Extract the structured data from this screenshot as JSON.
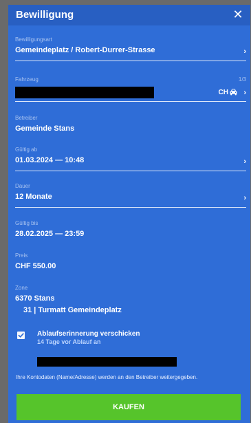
{
  "header": {
    "title": "Bewilligung",
    "close_glyph": "✕"
  },
  "fields": {
    "bewilligungsart": {
      "label": "Bewilligungsart",
      "value": "Gemeindeplatz / Robert-Durrer-Strasse"
    },
    "fahrzeug": {
      "label": "Fahrzeug",
      "counter": "1/3",
      "country": "CH",
      "icon": "car-icon"
    },
    "betreiber": {
      "label": "Betreiber",
      "value": "Gemeinde Stans"
    },
    "gueltig_ab": {
      "label": "Gültig ab",
      "value": "01.03.2024 — 10:48"
    },
    "dauer": {
      "label": "Dauer",
      "value": "12 Monate"
    },
    "gueltig_bis": {
      "label": "Gültig bis",
      "value": "28.02.2025 — 23:59"
    },
    "preis": {
      "label": "Preis",
      "value": "CHF 550.00"
    },
    "zone": {
      "label": "Zone",
      "value": "6370 Stans",
      "sub_value": "31 | Turmatt Gemeindeplatz"
    }
  },
  "chevron": "›",
  "reminder": {
    "checked": true,
    "label": "Ablaufserinnerung verschicken",
    "sub_label": "14 Tage vor Ablauf an"
  },
  "disclaimer": "Ihre Kontodaten (Name/Adresse) werden an den Betreiber weitergegeben.",
  "buy_button": "KAUFEN",
  "colors": {
    "panel": "#2f6dd7",
    "header": "#285fc2",
    "buy_button": "#56c42b",
    "backdrop": "#6a6a6a"
  }
}
